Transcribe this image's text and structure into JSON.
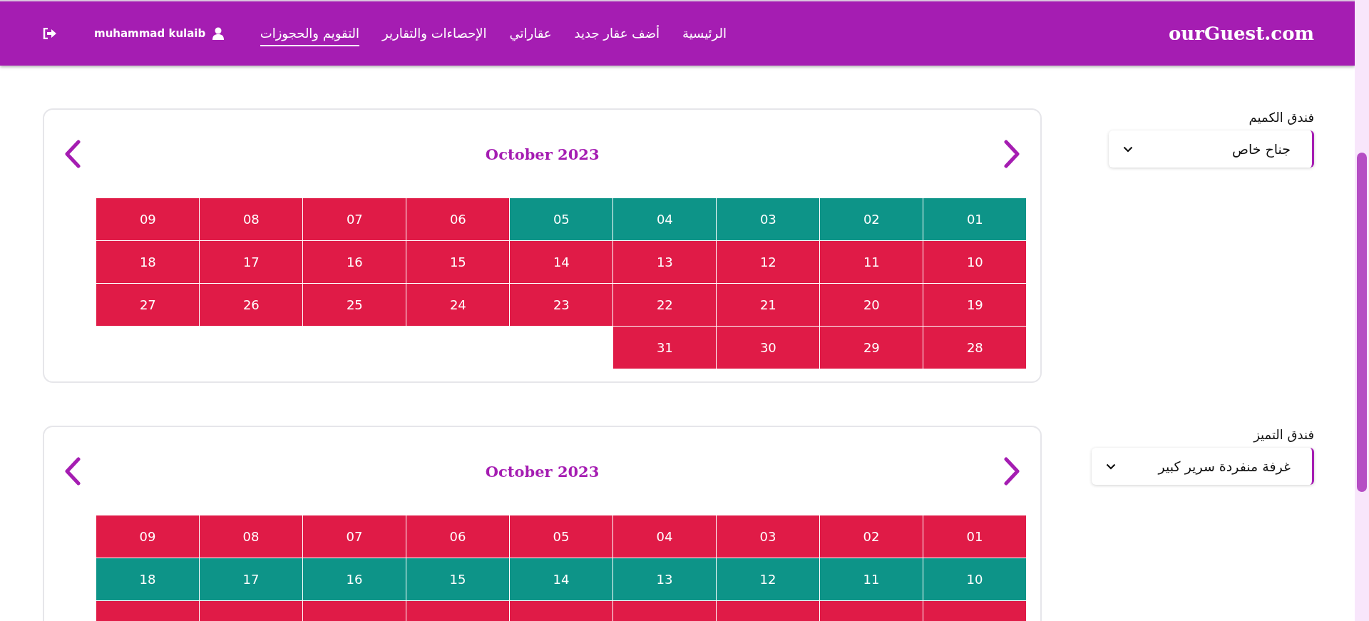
{
  "header": {
    "logo": "ourGuest.com",
    "nav": [
      {
        "label": "الرئيسية",
        "selected": false
      },
      {
        "label": "أضف عقار جديد",
        "selected": false
      },
      {
        "label": "عقاراتي",
        "selected": false
      },
      {
        "label": "الإحصاءات والتقارير",
        "selected": false
      },
      {
        "label": "التقويم والحجوزات",
        "selected": true
      }
    ],
    "user": "muhammad kulaib"
  },
  "properties": [
    {
      "hotel": "فندق الكميم",
      "unit": "جناح خاص",
      "calendar": {
        "month": "October 2023",
        "days": [
          {
            "day": "01",
            "booked": false
          },
          {
            "day": "02",
            "booked": false
          },
          {
            "day": "03",
            "booked": false
          },
          {
            "day": "04",
            "booked": false
          },
          {
            "day": "05",
            "booked": false
          },
          {
            "day": "06",
            "booked": true
          },
          {
            "day": "07",
            "booked": true
          },
          {
            "day": "08",
            "booked": true
          },
          {
            "day": "09",
            "booked": true
          },
          {
            "day": "10",
            "booked": true
          },
          {
            "day": "11",
            "booked": true
          },
          {
            "day": "12",
            "booked": true
          },
          {
            "day": "13",
            "booked": true
          },
          {
            "day": "14",
            "booked": true
          },
          {
            "day": "15",
            "booked": true
          },
          {
            "day": "16",
            "booked": true
          },
          {
            "day": "17",
            "booked": true
          },
          {
            "day": "18",
            "booked": true
          },
          {
            "day": "19",
            "booked": true
          },
          {
            "day": "20",
            "booked": true
          },
          {
            "day": "21",
            "booked": true
          },
          {
            "day": "22",
            "booked": true
          },
          {
            "day": "23",
            "booked": true
          },
          {
            "day": "24",
            "booked": true
          },
          {
            "day": "25",
            "booked": true
          },
          {
            "day": "26",
            "booked": true
          },
          {
            "day": "27",
            "booked": true
          },
          {
            "day": "28",
            "booked": true
          },
          {
            "day": "29",
            "booked": true
          },
          {
            "day": "30",
            "booked": true
          },
          {
            "day": "31",
            "booked": true
          }
        ]
      }
    },
    {
      "hotel": "فندق التميز",
      "unit": "غرفة منفردة سرير كبير",
      "calendar": {
        "month": "October 2023",
        "days": [
          {
            "day": "01",
            "booked": true
          },
          {
            "day": "02",
            "booked": true
          },
          {
            "day": "03",
            "booked": true
          },
          {
            "day": "04",
            "booked": true
          },
          {
            "day": "05",
            "booked": true
          },
          {
            "day": "06",
            "booked": true
          },
          {
            "day": "07",
            "booked": true
          },
          {
            "day": "08",
            "booked": true
          },
          {
            "day": "09",
            "booked": true
          },
          {
            "day": "10",
            "booked": false
          },
          {
            "day": "11",
            "booked": false
          },
          {
            "day": "12",
            "booked": false
          },
          {
            "day": "13",
            "booked": false
          },
          {
            "day": "14",
            "booked": false
          },
          {
            "day": "15",
            "booked": false
          },
          {
            "day": "16",
            "booked": false
          },
          {
            "day": "17",
            "booked": false
          },
          {
            "day": "18",
            "booked": false
          },
          {
            "booked": true
          },
          {
            "booked": true
          },
          {
            "booked": true
          },
          {
            "booked": true
          },
          {
            "booked": true
          },
          {
            "booked": true
          },
          {
            "booked": true
          },
          {
            "booked": true
          },
          {
            "booked": true
          }
        ]
      }
    }
  ]
}
